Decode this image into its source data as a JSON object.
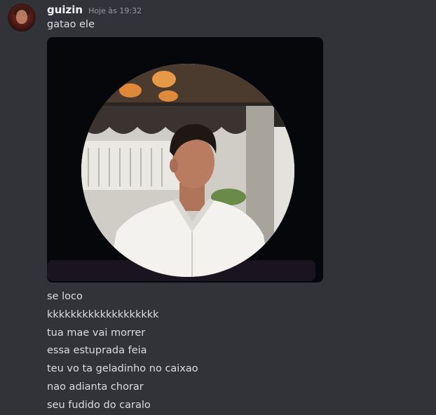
{
  "message": {
    "username": "guizin",
    "timestamp": "Hoje às 19:32",
    "first_line": "gatao ele",
    "attachment": {
      "type": "image",
      "description_icon": "profile-photo"
    },
    "lines": [
      "se loco",
      "kkkkkkkkkkkkkkkkkkk",
      "tua mae vai morrer",
      "essa estuprada feia",
      "teu vo ta geladinho no caixao",
      "nao adianta chorar",
      "seu fudido do caralo"
    ]
  },
  "colors": {
    "background": "#313338",
    "text": "#dbdee1",
    "username": "#f2f3f5",
    "timestamp": "#949ba4",
    "attachment_bg": "#06070a"
  }
}
